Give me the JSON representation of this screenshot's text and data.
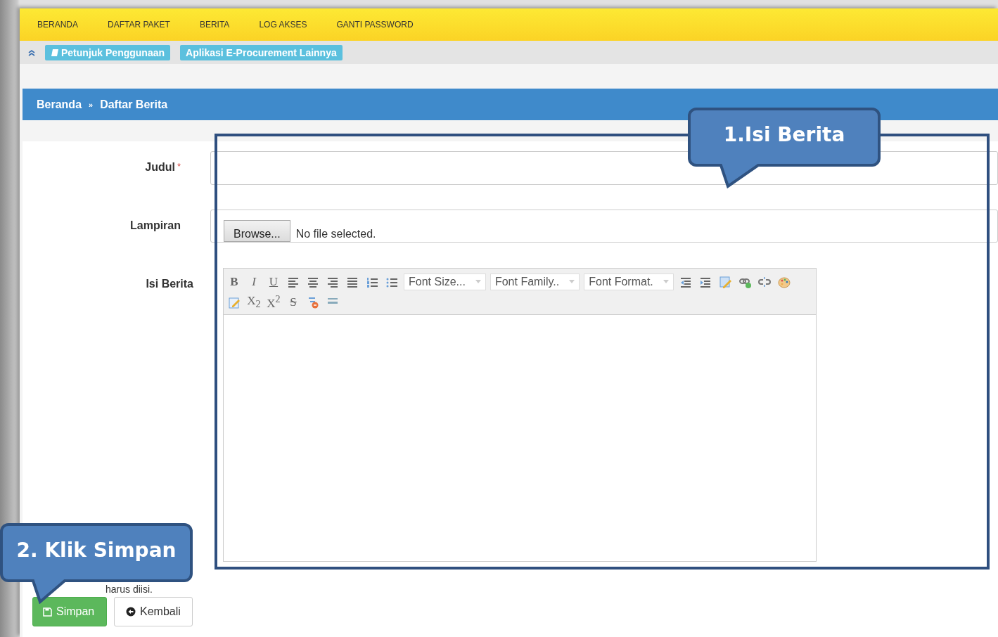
{
  "nav": {
    "items": [
      {
        "label": "BERANDA"
      },
      {
        "label": "DAFTAR PAKET"
      },
      {
        "label": "BERITA"
      },
      {
        "label": "LOG AKSES"
      },
      {
        "label": "GANTI PASSWORD"
      }
    ]
  },
  "subbar": {
    "links": [
      {
        "label": "Petunjuk Penggunaan",
        "kind": "book"
      },
      {
        "label": "Aplikasi E-Procurement Lainnya",
        "kind": "plain"
      }
    ]
  },
  "breadcrumb": {
    "items": [
      "Beranda",
      "Daftar Berita"
    ],
    "separator": "»"
  },
  "form": {
    "fields": [
      {
        "label": "Judul",
        "required_mark": "*",
        "kind": "text"
      },
      {
        "label": "Lampiran",
        "kind": "file",
        "button": "Browse...",
        "status": "No file selected."
      },
      {
        "label": "Isi Berita",
        "kind": "editor"
      }
    ],
    "editor": {
      "rows": [
        [
          {
            "kind": "glyph",
            "text": "B"
          },
          {
            "kind": "glyph",
            "text": "I"
          },
          {
            "kind": "glyph",
            "text": "U"
          },
          {
            "kind": "icon"
          },
          {
            "kind": "icon"
          },
          {
            "kind": "icon"
          },
          {
            "kind": "icon"
          },
          {
            "kind": "icon"
          },
          {
            "kind": "icon"
          },
          {
            "kind": "select",
            "label": "Font Size..."
          },
          {
            "kind": "select",
            "label": "Font Family.."
          },
          {
            "kind": "select",
            "label": "Font Format."
          },
          {
            "kind": "icon"
          },
          {
            "kind": "icon"
          },
          {
            "kind": "icon"
          },
          {
            "kind": "icon"
          },
          {
            "kind": "icon"
          },
          {
            "kind": "icon"
          }
        ],
        [
          {
            "kind": "icon"
          },
          {
            "kind": "glyph",
            "text": "X$_{2}$"
          },
          {
            "kind": "glyph",
            "text": "X$^{2}$"
          },
          {
            "kind": "glyph",
            "text": "S"
          },
          {
            "kind": "icon"
          },
          {
            "kind": "icon"
          }
        ]
      ]
    },
    "note": "harus diisi.",
    "buttons": [
      {
        "label": "Simpan",
        "kind": "primary"
      },
      {
        "label": "Kembali",
        "kind": "default"
      }
    ]
  },
  "callouts": [
    {
      "text": "1.Isi Berita",
      "kind": "top"
    },
    {
      "text": "2. Klik Simpan",
      "kind": "bottom"
    }
  ]
}
